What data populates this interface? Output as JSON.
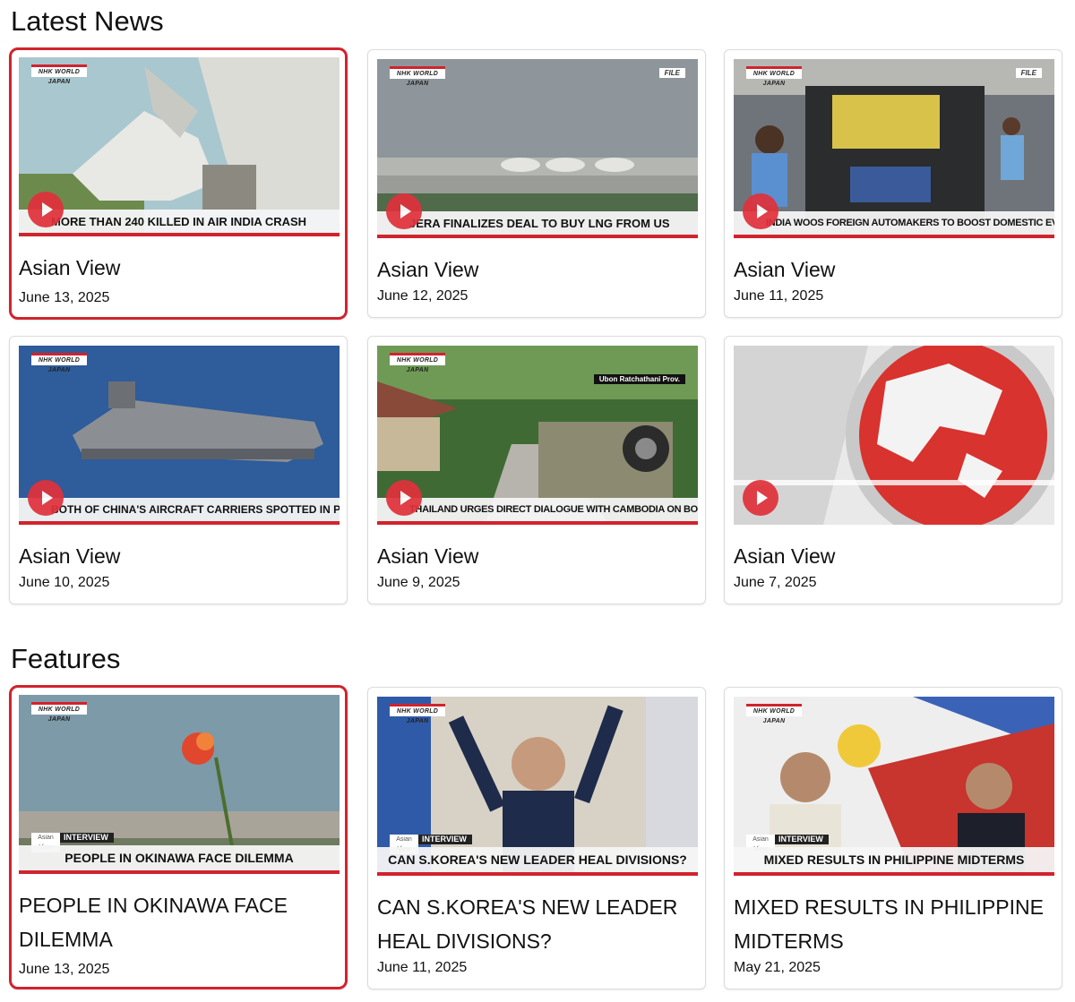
{
  "sections": {
    "latest_title": "Latest News",
    "features_title": "Features"
  },
  "latest": [
    {
      "title": "Asian View",
      "date": "June 13, 2025",
      "caption": "MORE THAN 240 KILLED IN AIR INDIA CRASH",
      "logo": "NHK WORLD JAPAN"
    },
    {
      "title": "Asian View",
      "date": "June 12, 2025",
      "caption": "JERA FINALIZES DEAL TO BUY LNG FROM US",
      "logo": "NHK WORLD JAPAN",
      "badge": "FILE"
    },
    {
      "title": "Asian View",
      "date": "June 11, 2025",
      "caption": "INDIA WOOS FOREIGN AUTOMAKERS TO BOOST DOMESTIC EV PRODUCTION",
      "logo": "NHK WORLD JAPAN",
      "badge": "FILE"
    },
    {
      "title": "Asian View",
      "date": "June 10, 2025",
      "caption": "BOTH OF CHINA'S AIRCRAFT CARRIERS SPOTTED IN PACIFIC",
      "logo": "NHK WORLD JAPAN"
    },
    {
      "title": "Asian View",
      "date": "June 9, 2025",
      "caption": "THAILAND URGES DIRECT DIALOGUE WITH CAMBODIA ON BORDER CLASH",
      "logo": "NHK WORLD JAPAN",
      "badge": "Ubon Ratchathani Prov."
    },
    {
      "title": "Asian View",
      "date": "June 7, 2025"
    }
  ],
  "features": [
    {
      "title": "PEOPLE IN OKINAWA FACE DILEMMA",
      "date": "June 13, 2025",
      "caption": "PEOPLE IN OKINAWA FACE DILEMMA",
      "tag": "INTERVIEW",
      "logo": "NHK WORLD JAPAN"
    },
    {
      "title": "CAN S.KOREA'S NEW LEADER HEAL DIVISIONS?",
      "date": "June 11, 2025",
      "caption": "CAN S.KOREA'S NEW LEADER HEAL DIVISIONS?",
      "tag": "INTERVIEW",
      "logo": "NHK WORLD JAPAN"
    },
    {
      "title": "MIXED RESULTS IN PHILIPPINE MIDTERMS",
      "date": "May 21, 2025",
      "caption": "MIXED RESULTS IN PHILIPPINE MIDTERMS",
      "tag": "INTERVIEW",
      "logo": "NHK WORLD JAPAN"
    }
  ],
  "colors": {
    "accent": "#d1232e",
    "play": "#e0313b"
  }
}
